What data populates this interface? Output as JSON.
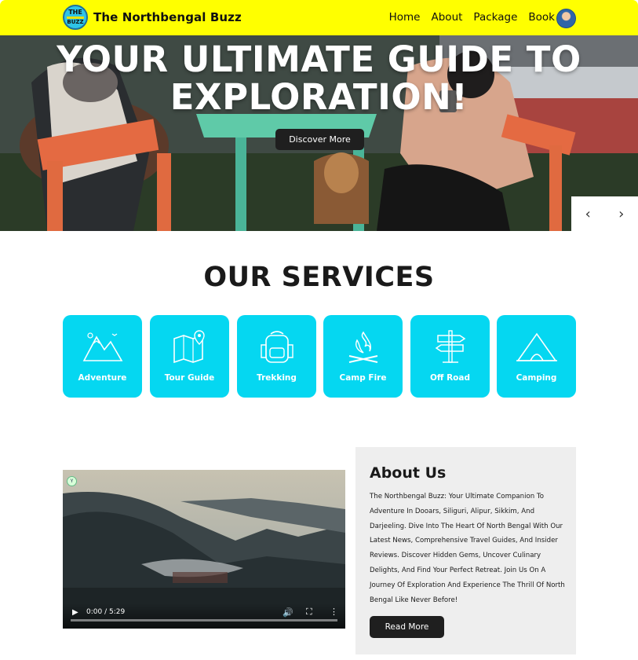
{
  "brand": {
    "name": "The Northbengal Buzz",
    "logo_top": "THE",
    "logo_bottom": "BUZZ"
  },
  "nav": {
    "items": [
      "Home",
      "About",
      "Package",
      "Book"
    ]
  },
  "hero": {
    "title_line1": "YOUR ULTIMATE GUIDE TO",
    "title_line2": "EXPLORATION!",
    "cta": "Discover More",
    "prev_icon": "‹",
    "next_icon": "›"
  },
  "services": {
    "title": "OUR SERVICES",
    "items": [
      {
        "label": "Adventure",
        "icon": "mountain-icon"
      },
      {
        "label": "Tour Guide",
        "icon": "map-icon"
      },
      {
        "label": "Trekking",
        "icon": "backpack-icon"
      },
      {
        "label": "Camp Fire",
        "icon": "campfire-icon"
      },
      {
        "label": "Off Road",
        "icon": "signpost-icon"
      },
      {
        "label": "Camping",
        "icon": "tent-icon"
      }
    ]
  },
  "video": {
    "time": "0:00 / 5:29"
  },
  "about": {
    "title": "About Us",
    "body": "The Northbengal Buzz: Your Ultimate Companion To Adventure In Dooars, Siliguri, Alipur, Sikkim, And Darjeeling. Dive Into The Heart Of North Bengal With Our Latest News, Comprehensive Travel Guides, And Insider Reviews. Discover Hidden Gems, Uncover Culinary Delights, And Find Your Perfect Retreat. Join Us On A Journey Of Exploration And Experience The Thrill Of North Bengal Like Never Before!",
    "cta": "Read More"
  },
  "colors": {
    "nav_bg": "#ffff00",
    "service_card": "#05d7f1",
    "button_dark": "#1f1f1f",
    "about_bg": "#eeeeee"
  }
}
